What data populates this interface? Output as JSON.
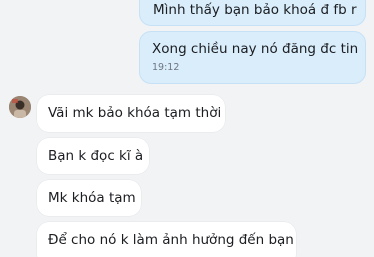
{
  "messages": [
    {
      "side": "out",
      "text": "Mình thấy bạn bảo khoá đ  fb r"
    },
    {
      "side": "out",
      "text": "Xong chiều nay nó đăng đc tin",
      "time": "19:12"
    },
    {
      "side": "in",
      "text": "Vãi mk bảo khóa tạm thời"
    },
    {
      "side": "in",
      "text": "Bạn k đọc kĩ à"
    },
    {
      "side": "in",
      "text": "Mk khóa tạm"
    },
    {
      "side": "in",
      "text": "Để cho nó k làm ảnh hưởng đến bạn"
    }
  ],
  "colors": {
    "outgoing_bubble": "#d9edfb",
    "incoming_bubble": "#ffffff",
    "background": "#f2f3f5"
  },
  "icons": {
    "contact_avatar": "avatar-icon"
  }
}
